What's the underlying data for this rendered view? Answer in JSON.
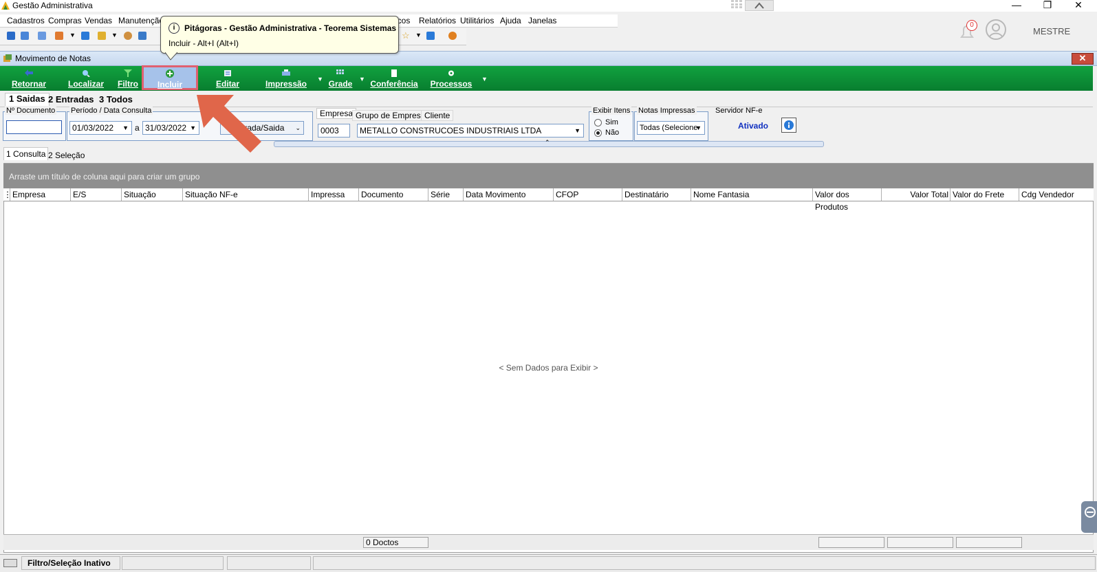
{
  "window": {
    "title": "Gestão Administrativa"
  },
  "menu": [
    "Cadastros",
    "Compras",
    "Vendas",
    "Manutenção",
    "icos",
    "Relatórios",
    "Utilitários",
    "Ajuda",
    "Janelas"
  ],
  "user": {
    "name": "MESTRE",
    "notifications": "0"
  },
  "child_window": {
    "title": "Movimento de Notas"
  },
  "ribbon": {
    "retornar": "Retornar",
    "localizar": "Localizar",
    "filtro": "Filtro",
    "incluir": "Incluir",
    "editar": "Editar",
    "impressao": "Impressão",
    "grade": "Grade",
    "conferencia": "Conferência",
    "processos": "Processos"
  },
  "tabs": {
    "saidas": "1 Saidas",
    "entradas": "2 Entradas",
    "todos": "3 Todos"
  },
  "filters": {
    "doc_label": "Nº Documento",
    "doc_value": "",
    "period_label": "Período / Data Consulta",
    "date_from": "01/03/2022",
    "date_sep": "a",
    "date_to": "31/03/2022",
    "type_value": "trada/Saida",
    "empresa_tab": "Empresa",
    "grupo_tab": "Grupo de Empresa",
    "cliente_tab": "Cliente",
    "empresa_code": "0003",
    "empresa_name": "METALLO CONSTRUCOES INDUSTRIAIS LTDA",
    "exibir_label": "Exibir Itens",
    "exibir_sim": "Sim",
    "exibir_nao": "Não",
    "notas_label": "Notas Impressas",
    "notas_value": "Todas (Selecione",
    "servidor_label": "Servidor NF-e",
    "servidor_status": "Ativado"
  },
  "tooltip": {
    "title": "Pitágoras - Gestão Administrativa - Teorema Sistemas",
    "text": "Incluir - Alt+I (Alt+I)"
  },
  "subtabs": {
    "consulta": "1 Consulta",
    "selecao": "2 Seleção"
  },
  "grid": {
    "group_hint": "Arraste um título de coluna aqui para criar um grupo",
    "columns": [
      "Empresa",
      "E/S",
      "Situação",
      "Situação NF-e",
      "Impressa",
      "Documento",
      "Série",
      "Data Movimento",
      "CFOP",
      "Destinatário",
      "Nome Fantasia",
      "Valor dos Produtos",
      "Valor Total",
      "Valor do Frete",
      "Cdg Vendedor"
    ],
    "empty_message": "< Sem Dados para Exibir >",
    "doc_count": "0 Doctos"
  },
  "status": {
    "filter_state": "Filtro/Seleção Inativo"
  },
  "colors": {
    "ribbon": "#0a8f35",
    "highlight": "#e06070",
    "arrow": "#e0664a",
    "status_active": "#1030c0"
  }
}
